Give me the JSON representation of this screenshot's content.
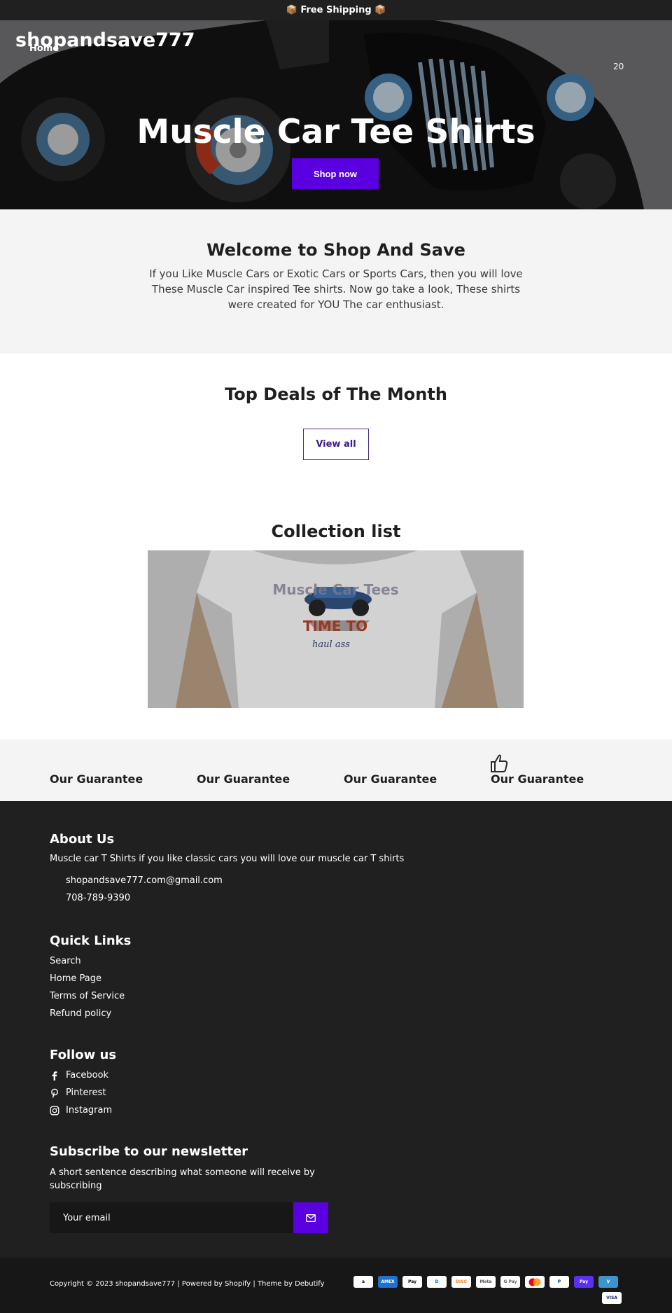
{
  "announcement": {
    "text": "📦 Free Shipping 📦"
  },
  "header": {
    "brand": "shopandsave777",
    "nav_home": "Home",
    "cart_count": "20"
  },
  "hero": {
    "title": "Muscle Car Tee Shirts",
    "button": "Shop now"
  },
  "welcome": {
    "title": "Welcome to Shop And Save",
    "text": "If you Like Muscle Cars or Exotic Cars or Sports Cars, then you will love These Muscle Car inspired Tee shirts. Now go take a look, These shirts were created for YOU The car enthusiast."
  },
  "deals": {
    "title": "Top Deals of The Month",
    "button": "View all"
  },
  "collection": {
    "title": "Collection list",
    "card_label": "Muscle Car Tees",
    "shirt_text_1": "TIME TO",
    "shirt_text_2": "haul ass"
  },
  "guarantees": [
    "Our Guarantee",
    "Our Guarantee",
    "Our Guarantee",
    "Our Guarantee"
  ],
  "footer": {
    "about_title": "About Us",
    "about_text": "Muscle car T Shirts if you like classic cars you will love our muscle car T shirts",
    "email": "shopandsave777.com@gmail.com",
    "phone": "708-789-9390",
    "quick_title": "Quick Links",
    "quick_links": [
      "Search",
      "Home Page",
      "Terms of Service",
      "Refund policy"
    ],
    "follow_title": "Follow us",
    "social": [
      "Facebook",
      "Pinterest",
      "Instagram"
    ],
    "newsletter_title": "Subscribe to our newsletter",
    "newsletter_text": "A short sentence describing what someone will receive by subscribing",
    "email_placeholder": "Your email"
  },
  "bottom": {
    "copyright": "Copyright © 2023 shopandsave777 | Powered by Shopify | Theme by Debutify",
    "payments": [
      "amazon",
      "amex",
      "apple-pay",
      "diners",
      "discover",
      "meta-pay",
      "google-pay",
      "mastercard",
      "paypal",
      "shop-pay",
      "venmo",
      "visa"
    ]
  },
  "colors": {
    "accent": "#5a00e0",
    "dark": "#202020",
    "light_bg": "#f4f4f4"
  }
}
